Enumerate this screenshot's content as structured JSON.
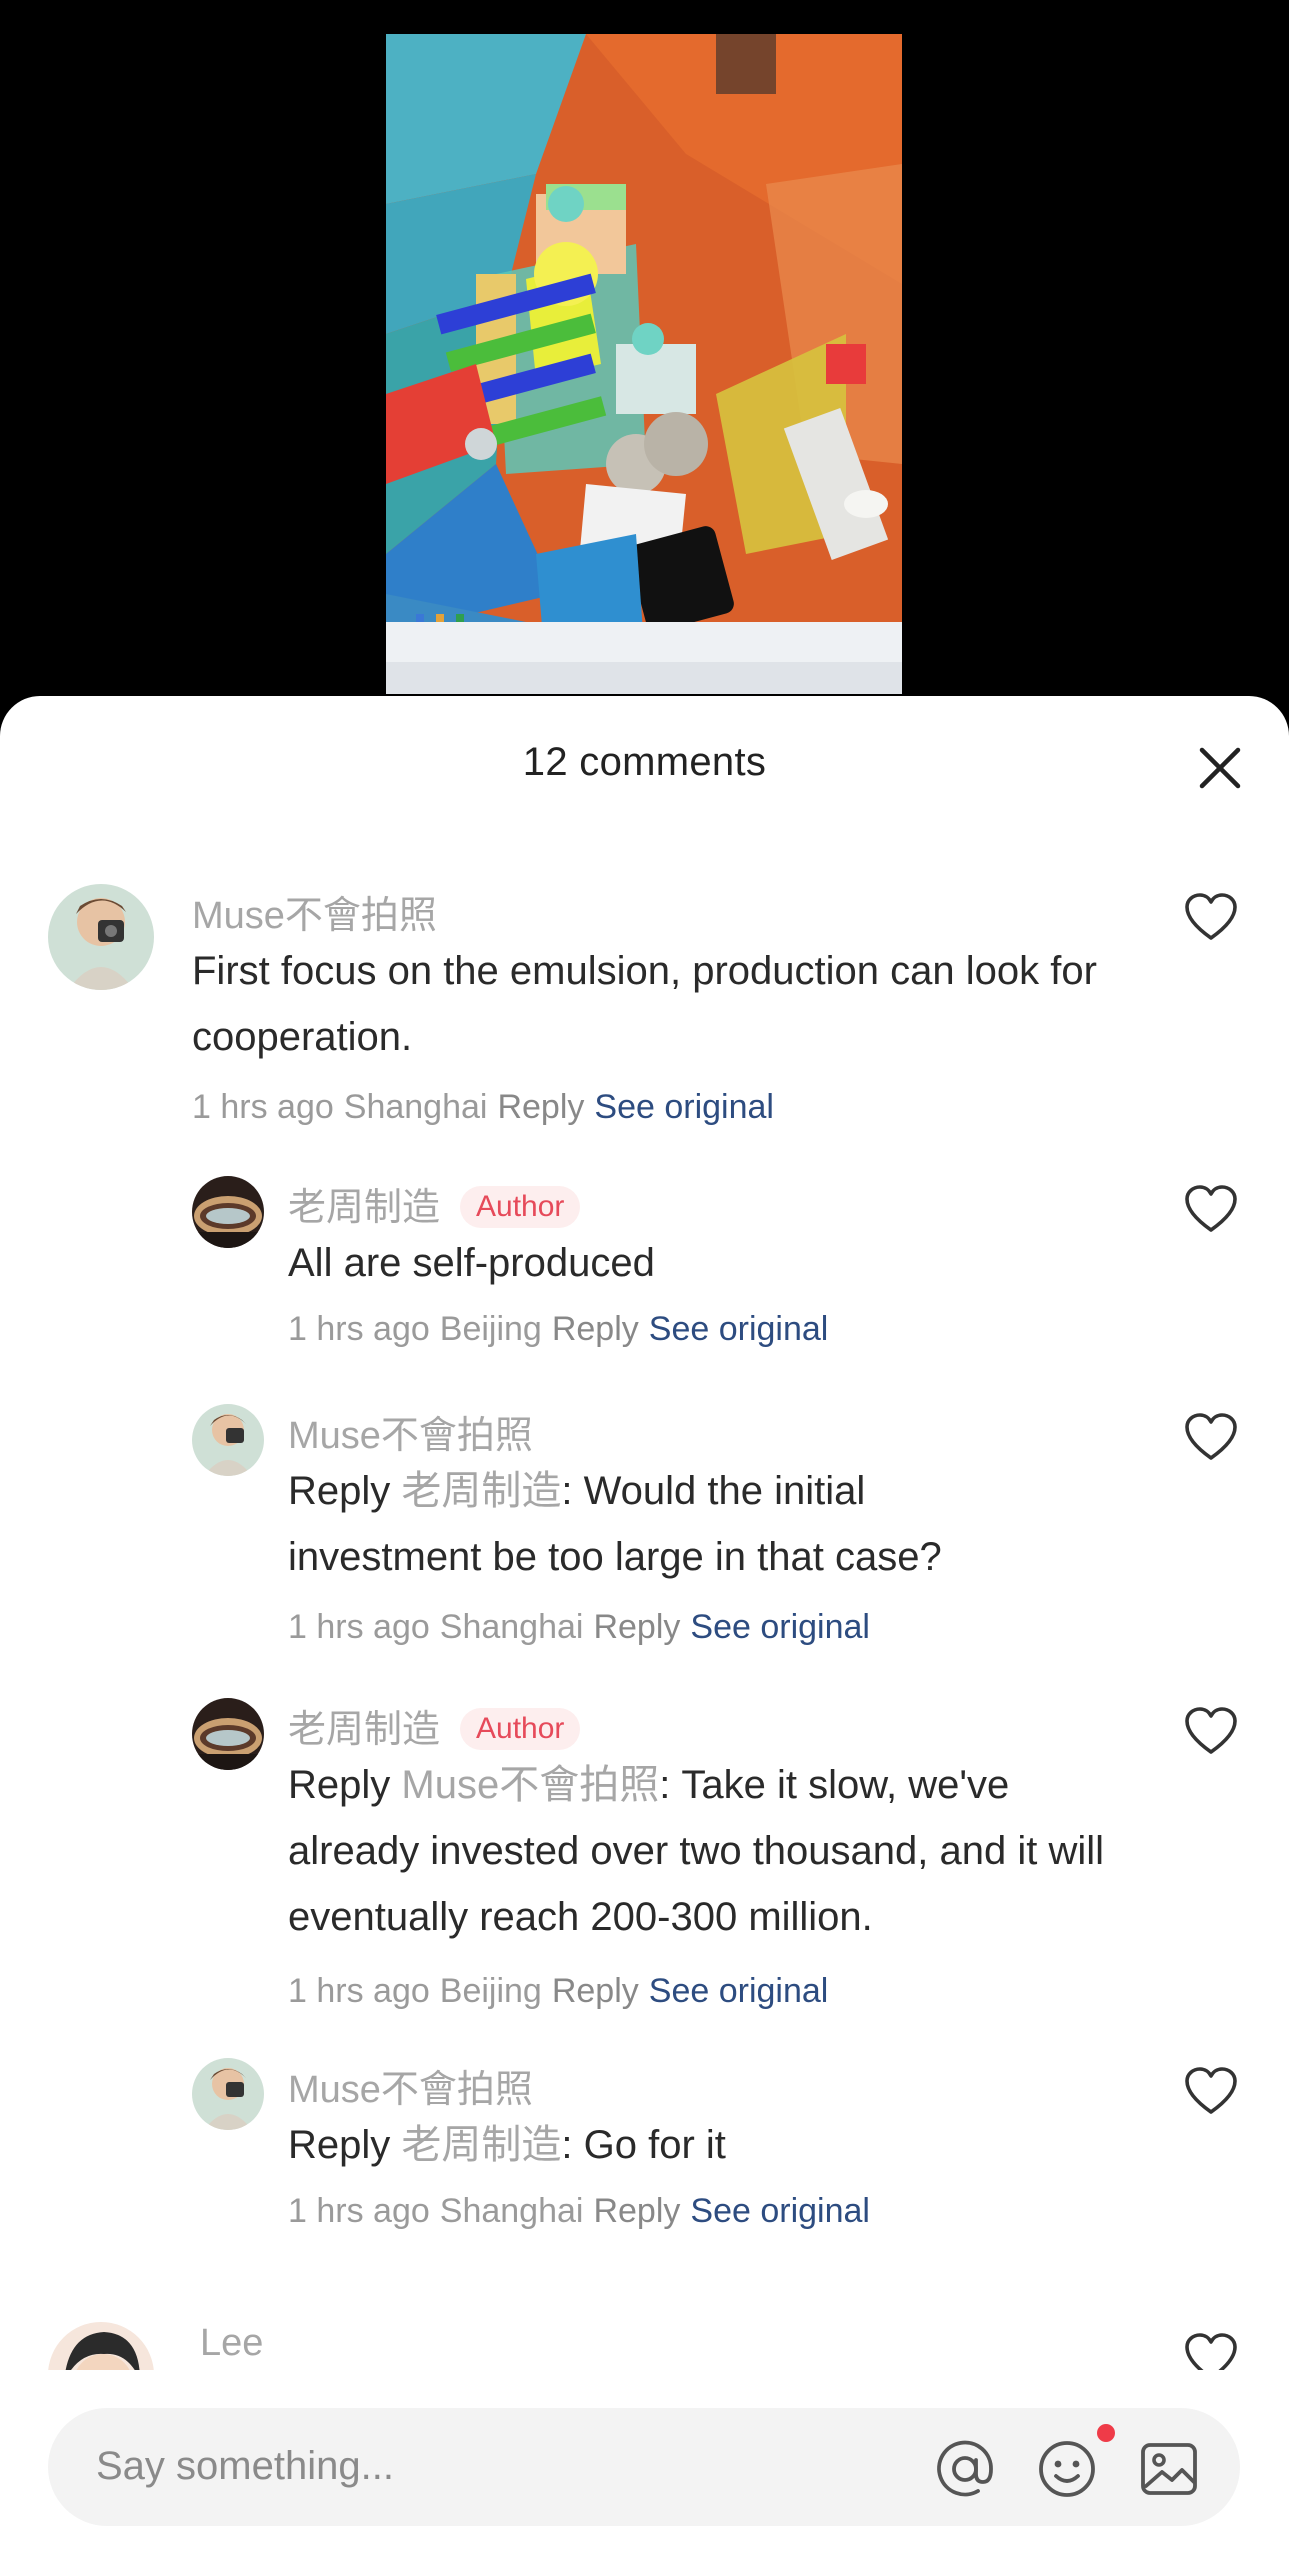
{
  "sheet": {
    "title": "12 comments"
  },
  "comments": [
    {
      "user": "Muse不會拍照",
      "text": "First focus on the emulsion, production can look for cooperation.",
      "time": "1 hrs ago",
      "location": "Shanghai",
      "reply_label": "Reply",
      "see_original": "See original"
    },
    {
      "user": "老周制造",
      "badge": "Author",
      "text": "All are self-produced",
      "time": "1 hrs ago",
      "location": "Beijing",
      "reply_label": "Reply",
      "see_original": "See original"
    },
    {
      "user": "Muse不會拍照",
      "reply_prefix": "Reply",
      "mention": "老周制造",
      "text": ": Would the initial investment be too large in that case?",
      "time": "1 hrs ago",
      "location": "Shanghai",
      "reply_label": "Reply",
      "see_original": "See original"
    },
    {
      "user": "老周制造",
      "badge": "Author",
      "reply_prefix": "Reply",
      "mention": "Muse不會拍照",
      "text": ": Take it slow, we've already invested over two thousand, and it will eventually reach 200-300 million.",
      "time": "1 hrs ago",
      "location": "Beijing",
      "reply_label": "Reply",
      "see_original": "See original"
    },
    {
      "user": "Muse不會拍照",
      "reply_prefix": "Reply",
      "mention": "老周制造",
      "text": ": Go for it",
      "time": "1 hrs ago",
      "location": "Shanghai",
      "reply_label": "Reply",
      "see_original": "See original"
    },
    {
      "user": "Lee"
    }
  ],
  "input": {
    "placeholder": "Say something..."
  },
  "icons": {
    "close": "close-icon",
    "like": "heart-outline-icon",
    "mention": "at-icon",
    "emoji": "emoji-icon",
    "image": "image-icon"
  },
  "colors": {
    "author_badge_bg": "#fdeeee",
    "author_badge_text": "#e64a5a",
    "see_original": "#2d4c80",
    "notification_dot": "#ef3b48"
  }
}
